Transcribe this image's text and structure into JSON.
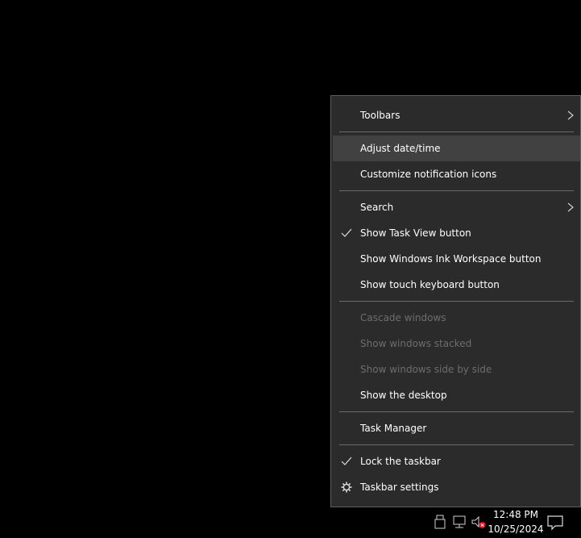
{
  "menu": {
    "items": [
      {
        "label": "Toolbars",
        "submenu": true
      },
      {
        "label": "Adjust date/time",
        "hovered": true
      },
      {
        "label": "Customize notification icons"
      },
      {
        "label": "Search",
        "submenu": true
      },
      {
        "label": "Show Task View button",
        "checked": true
      },
      {
        "label": "Show Windows Ink Workspace button"
      },
      {
        "label": "Show touch keyboard button"
      },
      {
        "label": "Cascade windows",
        "disabled": true
      },
      {
        "label": "Show windows stacked",
        "disabled": true
      },
      {
        "label": "Show windows side by side",
        "disabled": true
      },
      {
        "label": "Show the desktop"
      },
      {
        "label": "Task Manager"
      },
      {
        "label": "Lock the taskbar",
        "checked": true
      },
      {
        "label": "Taskbar settings",
        "icon": "gear-icon"
      }
    ]
  },
  "taskbar": {
    "time": "12:48 PM",
    "date": "10/25/2024",
    "icons": [
      "usb-drive-icon",
      "network-icon",
      "volume-muted-icon",
      "notifications-icon"
    ]
  },
  "colors": {
    "menu_bg": "#2b2b2b",
    "hover_bg": "#414141",
    "disabled_text": "#6d6d6d",
    "separator": "#6a6a6a",
    "desktop_bg": "#000000"
  }
}
